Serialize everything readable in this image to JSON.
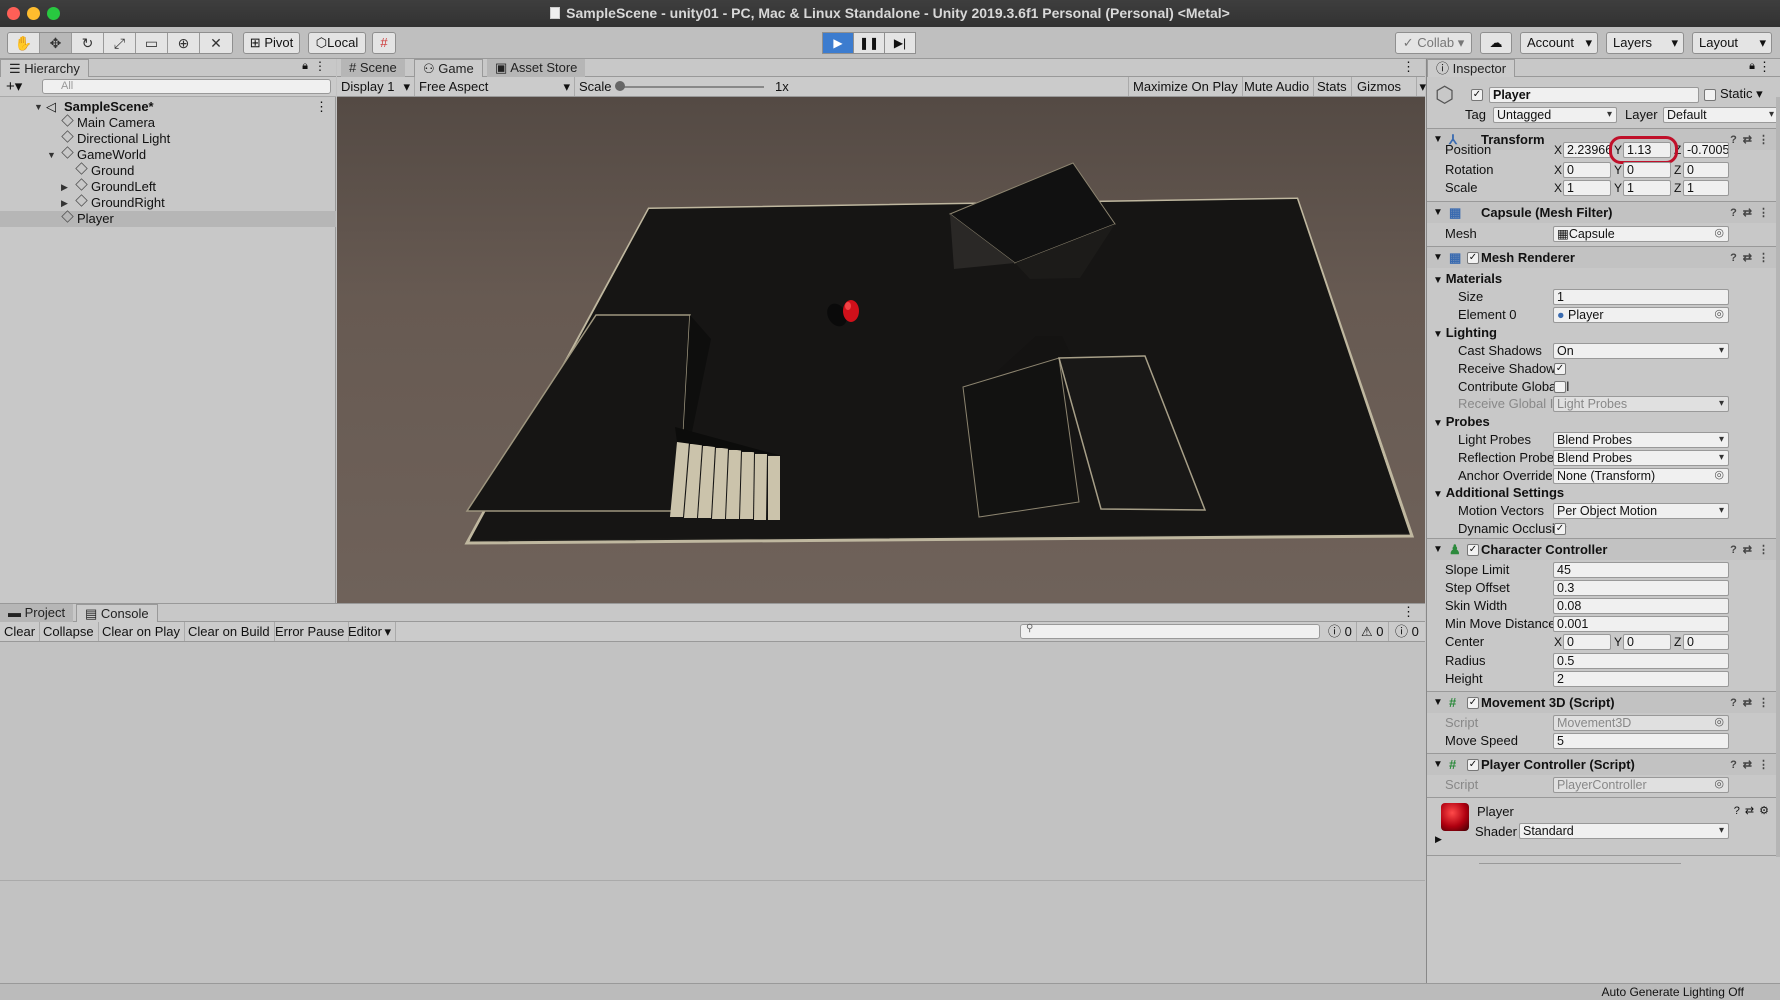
{
  "window": {
    "title": "SampleScene - unity01 - PC, Mac & Linux Standalone - Unity 2019.3.6f1 Personal (Personal) <Metal>"
  },
  "toolbar": {
    "tools": [
      "hand-icon",
      "move-icon",
      "rotate-icon",
      "scale-icon",
      "rect-icon",
      "transform-icon",
      "custom-tool-icon"
    ],
    "pivot_label": "Pivot",
    "local_label": "Local",
    "collab_label": "Collab",
    "account_label": "Account",
    "layers_label": "Layers",
    "layout_label": "Layout"
  },
  "hierarchy": {
    "tab": "Hierarchy",
    "search_placeholder": "All",
    "scene": "SampleScene*",
    "items": [
      {
        "label": "Main Camera"
      },
      {
        "label": "Directional Light"
      },
      {
        "label": "GameWorld"
      },
      {
        "label": "Ground"
      },
      {
        "label": "GroundLeft"
      },
      {
        "label": "GroundRight"
      },
      {
        "label": "Player"
      }
    ]
  },
  "game": {
    "tabs": [
      "Scene",
      "Game",
      "Asset Store"
    ],
    "display": "Display 1",
    "aspect": "Free Aspect",
    "scale_label": "Scale",
    "scale_value": "1x",
    "maximize": "Maximize On Play",
    "mute": "Mute Audio",
    "stats": "Stats",
    "gizmos": "Gizmos"
  },
  "console": {
    "tabs": [
      "Project",
      "Console"
    ],
    "buttons": [
      "Clear",
      "Collapse",
      "Clear on Play",
      "Clear on Build",
      "Error Pause",
      "Editor"
    ],
    "counts": {
      "info": "0",
      "warning": "0",
      "error": "0"
    }
  },
  "inspector": {
    "tab": "Inspector",
    "object_name": "Player",
    "static_label": "Static",
    "tag_label": "Tag",
    "tag_value": "Untagged",
    "layer_label": "Layer",
    "layer_value": "Default",
    "transform": {
      "title": "Transform",
      "position_label": "Position",
      "position": {
        "x": "2.23966",
        "y": "1.13",
        "z": "-0.7005"
      },
      "rotation_label": "Rotation",
      "rotation": {
        "x": "0",
        "y": "0",
        "z": "0"
      },
      "scale_label": "Scale",
      "scale": {
        "x": "1",
        "y": "1",
        "z": "1"
      }
    },
    "mesh_filter": {
      "title": "Capsule (Mesh Filter)",
      "mesh_label": "Mesh",
      "mesh_value": "Capsule"
    },
    "mesh_renderer": {
      "title": "Mesh Renderer",
      "materials": "Materials",
      "size_label": "Size",
      "size_value": "1",
      "element0_label": "Element 0",
      "element0_value": "Player",
      "lighting": "Lighting",
      "cast_shadows_label": "Cast Shadows",
      "cast_shadows_value": "On",
      "receive_shadows_label": "Receive Shadows",
      "contribute_gi_label": "Contribute Global Il",
      "receive_gi_label": "Receive Global Illu",
      "receive_gi_value": "Light Probes",
      "probes": "Probes",
      "light_probes_label": "Light Probes",
      "light_probes_value": "Blend Probes",
      "reflection_probes_label": "Reflection Probes",
      "reflection_probes_value": "Blend Probes",
      "anchor_override_label": "Anchor Override",
      "anchor_override_value": "None (Transform)",
      "additional": "Additional Settings",
      "motion_vectors_label": "Motion Vectors",
      "motion_vectors_value": "Per Object Motion",
      "dynamic_occlusion_label": "Dynamic Occlusior"
    },
    "character_controller": {
      "title": "Character Controller",
      "slope_limit_label": "Slope Limit",
      "slope_limit": "45",
      "step_offset_label": "Step Offset",
      "step_offset": "0.3",
      "skin_width_label": "Skin Width",
      "skin_width": "0.08",
      "min_move_label": "Min Move Distance",
      "min_move": "0.001",
      "center_label": "Center",
      "center": {
        "x": "0",
        "y": "0",
        "z": "0"
      },
      "radius_label": "Radius",
      "radius": "0.5",
      "height_label": "Height",
      "height": "2"
    },
    "movement3d": {
      "title": "Movement 3D (Script)",
      "script_label": "Script",
      "script_value": "Movement3D",
      "move_speed_label": "Move Speed",
      "move_speed": "5"
    },
    "player_controller": {
      "title": "Player Controller (Script)",
      "script_label": "Script",
      "script_value": "PlayerController"
    },
    "material": {
      "name": "Player",
      "shader_label": "Shader",
      "shader_value": "Standard"
    }
  },
  "status": {
    "right": "Auto Generate Lighting Off"
  },
  "colors": {
    "accent": "#3c7ccf",
    "highlight": "#c0102a",
    "player_sphere": "#d0101a"
  }
}
